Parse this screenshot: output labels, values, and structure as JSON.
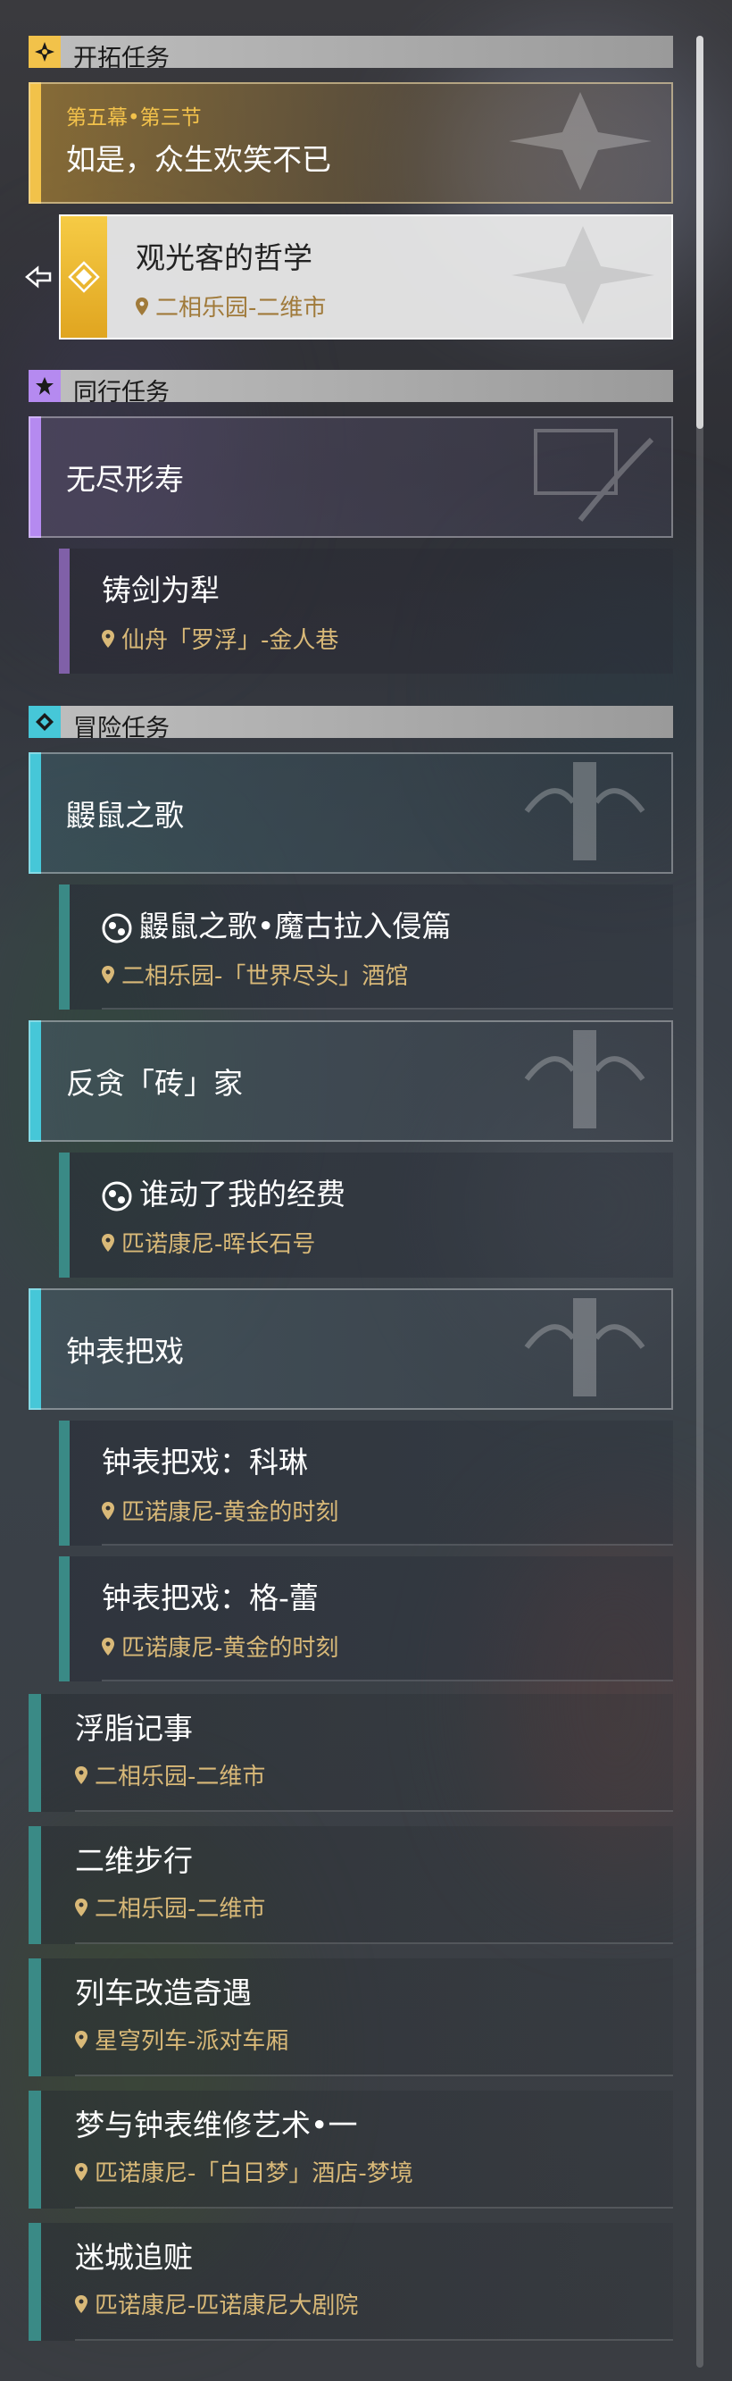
{
  "sections": {
    "trailblaze": {
      "title": "开拓任务"
    },
    "companion": {
      "title": "同行任务"
    },
    "adventure": {
      "title": "冒险任务"
    }
  },
  "trailblaze_main": {
    "act": "第五幕•第三节",
    "title": "如是，众生欢笑不已"
  },
  "trailblaze_sub": {
    "title": "观光客的哲学",
    "location": "二相乐园-二维市"
  },
  "companion_main": {
    "title": "无尽形寿"
  },
  "companion_sub": {
    "title": "铸剑为犁",
    "location": "仙舟「罗浮」-金人巷"
  },
  "adv1_main": {
    "title": "鼹鼠之歌"
  },
  "adv1_sub": {
    "title": "鼹鼠之歌•魔古拉入侵篇",
    "location": "二相乐园-「世界尽头」酒馆"
  },
  "adv2_main": {
    "title": "反贪「砖」家"
  },
  "adv2_sub": {
    "title": "谁动了我的经费",
    "location": "匹诺康尼-晖长石号"
  },
  "adv3_main": {
    "title": "钟表把戏"
  },
  "adv3_sub1": {
    "title": "钟表把戏：科琳",
    "location": "匹诺康尼-黄金的时刻"
  },
  "adv3_sub2": {
    "title": "钟表把戏：格-蕾",
    "location": "匹诺康尼-黄金的时刻"
  },
  "daily": [
    {
      "title": "浮脂记事",
      "location": "二相乐园-二维市"
    },
    {
      "title": "二维步行",
      "location": "二相乐园-二维市"
    },
    {
      "title": "列车改造奇遇",
      "location": "星穹列车-派对车厢"
    },
    {
      "title": "梦与钟表维修艺术•一",
      "location": "匹诺康尼-「白日梦」酒店-梦境"
    },
    {
      "title": "迷城追赃",
      "location": "匹诺康尼-匹诺康尼大剧院"
    }
  ],
  "colors": {
    "trailblaze": "#f2c24a",
    "companion": "#b58af0",
    "adventure": "#46c7d8",
    "daily": "#3a8a86",
    "location": "#d9b978"
  },
  "icons": [
    "trailblaze-emblem-icon",
    "star-icon",
    "diamond-icon",
    "location-pin-icon",
    "event-puzzle-icon",
    "tracking-arrow-icon"
  ]
}
